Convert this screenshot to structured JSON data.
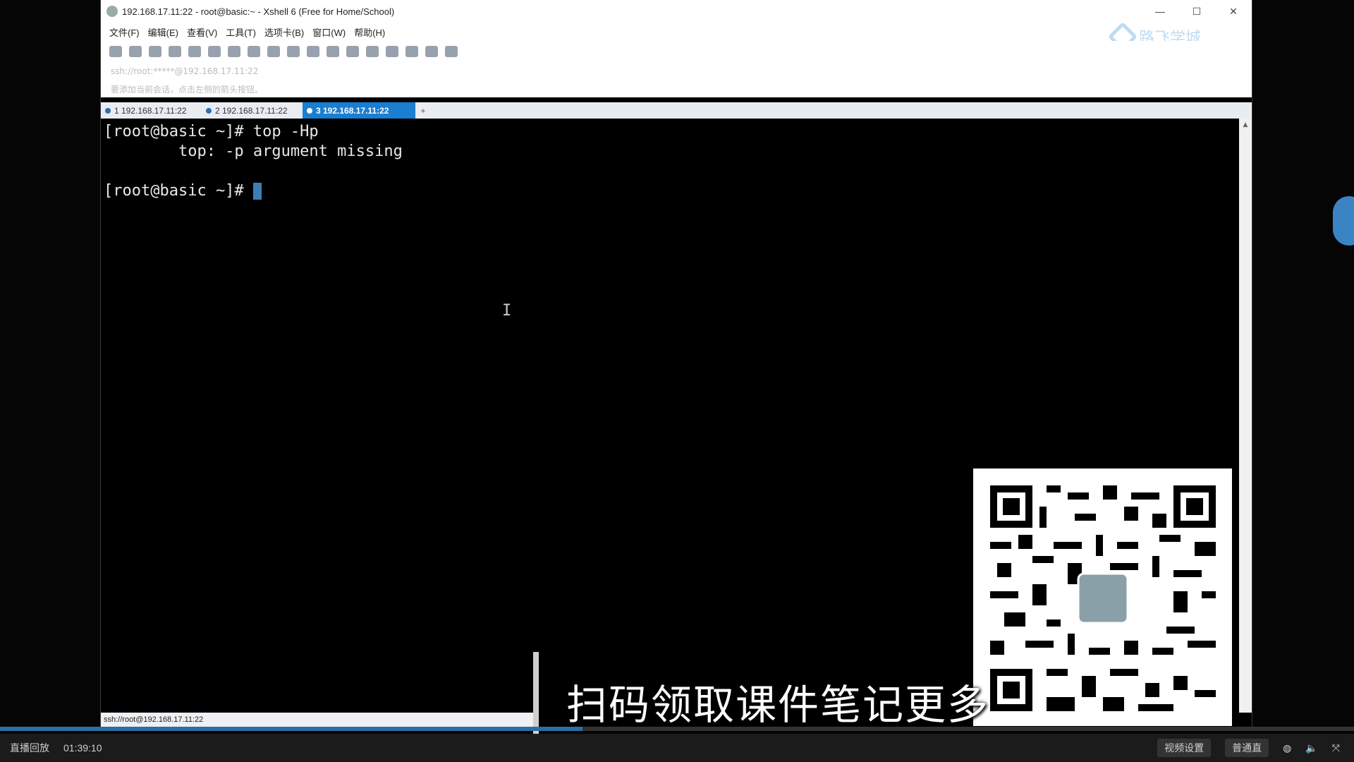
{
  "window": {
    "title": "192.168.17.11:22 - root@basic:~ - Xshell 6 (Free for Home/School)",
    "minimize": "—",
    "maximize": "☐",
    "close": "✕"
  },
  "menu": {
    "items": [
      "文件(F)",
      "编辑(E)",
      "查看(V)",
      "工具(T)",
      "选项卡(B)",
      "窗口(W)",
      "帮助(H)"
    ]
  },
  "brand": {
    "text": "路飞学城"
  },
  "address": {
    "text": "ssh://root:*****@192.168.17.11:22"
  },
  "info": {
    "text": "要添加当前会话，点击左侧的箭头按钮。"
  },
  "tabs": [
    {
      "label": "1 192.168.17.11:22"
    },
    {
      "label": "2 192.168.17.11:22"
    },
    {
      "label": "3 192.168.17.11:22"
    }
  ],
  "tab_add": "+",
  "terminal": {
    "lines": [
      "[root@basic ~]# top -Hp",
      "        top: -p argument missing",
      "",
      "[root@basic ~]# "
    ]
  },
  "statusbar": {
    "text": "ssh://root@192.168.17.11:22"
  },
  "subtitle": "扫码领取课件笔记更多",
  "player": {
    "left_label": "直播回放",
    "time": "01:39:10",
    "btn_settings": "视频设置",
    "btn_lines": "普通直",
    "progress": 0.43
  }
}
